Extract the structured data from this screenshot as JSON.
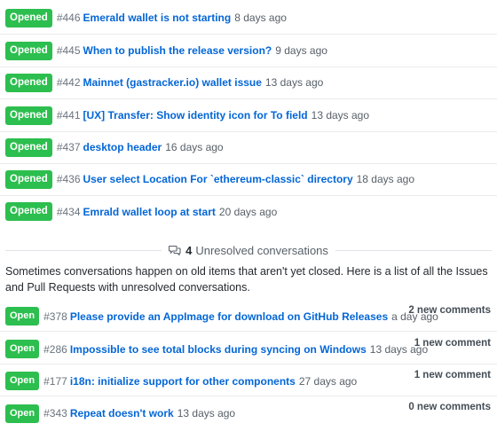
{
  "opened": [
    {
      "badge": "Opened",
      "number": "#446",
      "title": "Emerald wallet is not starting",
      "age": "8 days ago"
    },
    {
      "badge": "Opened",
      "number": "#445",
      "title": "When to publish the release version?",
      "age": "9 days ago"
    },
    {
      "badge": "Opened",
      "number": "#442",
      "title": "Mainnet (gastracker.io) wallet issue",
      "age": "13 days ago"
    },
    {
      "badge": "Opened",
      "number": "#441",
      "title": "[UX] Transfer: Show identity icon for To field",
      "age": "13 days ago"
    },
    {
      "badge": "Opened",
      "number": "#437",
      "title": "desktop header",
      "age": "16 days ago"
    },
    {
      "badge": "Opened",
      "number": "#436",
      "title": "User select Location For `ethereum-classic` directory",
      "age": "18 days ago"
    },
    {
      "badge": "Opened",
      "number": "#434",
      "title": "Emrald wallet loop at start",
      "age": "20 days ago"
    }
  ],
  "unresolved": {
    "count": "4",
    "label": "Unresolved conversations",
    "icon": "comment-discussion-icon",
    "description": "Sometimes conversations happen on old items that aren't yet closed. Here is a list of all the Issues and Pull Requests with unresolved conversations.",
    "items": [
      {
        "badge": "Open",
        "number": "#378",
        "title": "Please provide an AppImage for download on GitHub Releases",
        "age": "a day ago",
        "comments": "2 new comments"
      },
      {
        "badge": "Open",
        "number": "#286",
        "title": "Impossible to see total blocks during syncing on Windows",
        "age": "13 days ago",
        "comments": "1 new comment"
      },
      {
        "badge": "Open",
        "number": "#177",
        "title": "i18n: initialize support for other components",
        "age": "27 days ago",
        "comments": "1 new comment"
      },
      {
        "badge": "Open",
        "number": "#343",
        "title": "Repeat doesn't work",
        "age": "13 days ago",
        "comments": "0 new comments"
      }
    ]
  },
  "colors": {
    "badge_green": "#2cbe4e",
    "link_blue": "#0366d6",
    "muted": "#586069"
  }
}
